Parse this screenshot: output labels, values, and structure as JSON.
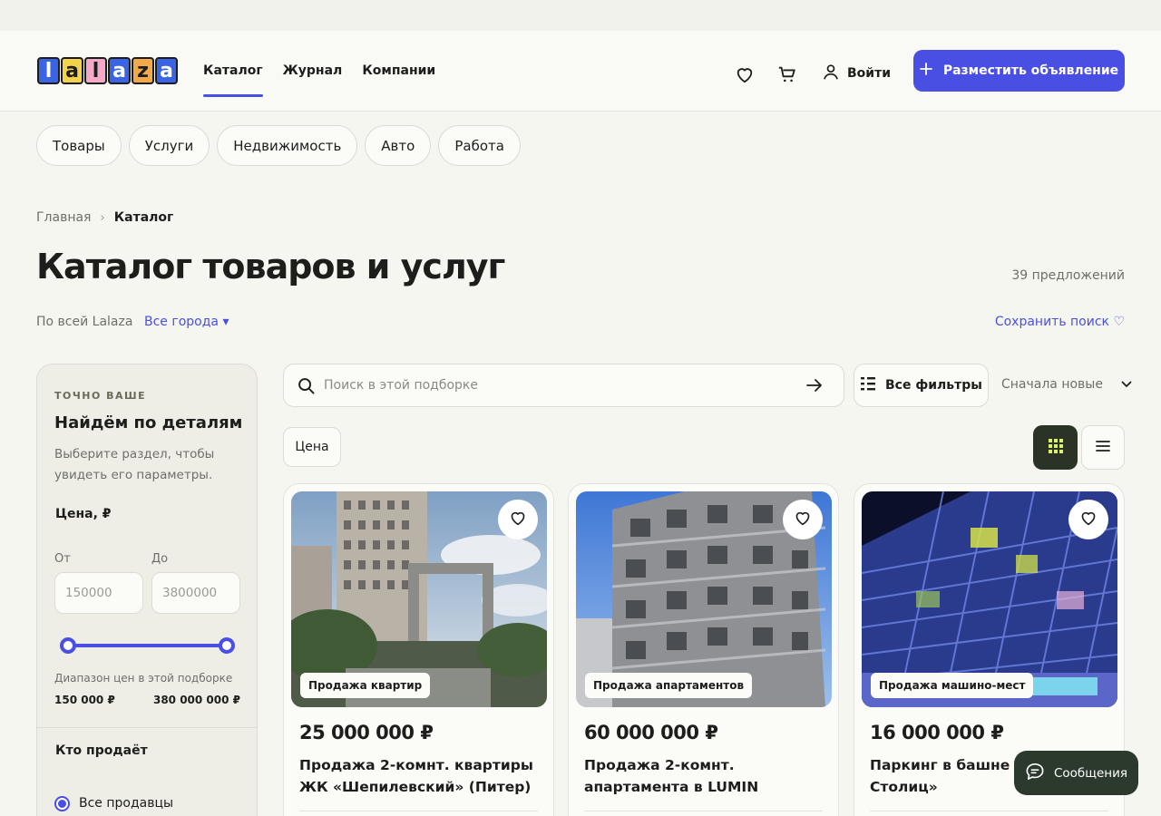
{
  "logo": {
    "letters": [
      "l",
      "a",
      "l",
      "a",
      "z",
      "a"
    ],
    "colors": [
      "#3a63e6",
      "#f2d34a",
      "#f4a9c8",
      "#3a63e6",
      "#f2a94a",
      "#3a63e6"
    ]
  },
  "nav": [
    {
      "label": "Каталог",
      "active": true
    },
    {
      "label": "Журнал",
      "active": false
    },
    {
      "label": "Компании",
      "active": false
    }
  ],
  "header": {
    "icons": [
      "heart-icon",
      "cart-icon",
      "user-icon"
    ],
    "login_label": "Войти",
    "post_button_label": "Разместить объявление"
  },
  "categories": [
    "Товары",
    "Услуги",
    "Недвижимость",
    "Авто",
    "Работа"
  ],
  "breadcrumb": {
    "home": "Главная",
    "separator": "›",
    "current": "Каталог"
  },
  "page": {
    "title": "Каталог товаров и услуг",
    "offers_count": "39 предложений",
    "scope": "По всей Lalaza",
    "cities": "Все города ▾",
    "save_search": "Сохранить поиск ♡"
  },
  "sidebar": {
    "eyebrow": "ТОЧНО ВАШЕ",
    "heading": "Найдём по деталям",
    "description": "Выберите раздел, чтобы увидеть его параметры.",
    "price_label": "Цена, ₽",
    "from_label": "От",
    "to_label": "До",
    "from_placeholder": "150000",
    "to_placeholder": "3800000",
    "range_label": "Диапазон цен в этой подборке",
    "range_min": "150 000 ₽",
    "range_max": "380 000 000 ₽",
    "seller_label": "Кто продаёт",
    "seller_option": "Все продавцы"
  },
  "toolbar": {
    "search_placeholder": "Поиск в этой подборке",
    "filters_label": "Все фильтры",
    "sort_label": "Сначала новые",
    "price_pill": "Цена",
    "view_mode": "grid"
  },
  "cards": [
    {
      "tag": "Продажа квартир",
      "price": "25 000 000 ₽",
      "title": "Продажа 2-комнт. квартиры ЖК «Шепилевский» (Питер)"
    },
    {
      "tag": "Продажа апартаментов",
      "price": "60 000 000 ₽",
      "title": "Продажа 2-комнт. апартамента в LUMIN"
    },
    {
      "tag": "Продажа машино-мест",
      "price": "16 000 000 ₽",
      "title": "Паркинг в башне «Город Столиц»"
    }
  ],
  "chat": {
    "label": "Сообщения"
  },
  "colors": {
    "accent": "#4a4fe3",
    "dark": "#2b3326",
    "background": "#f6f6f1"
  }
}
